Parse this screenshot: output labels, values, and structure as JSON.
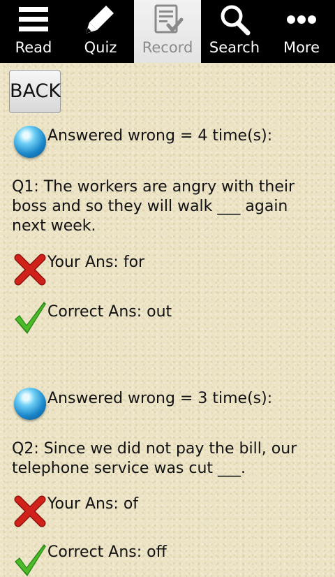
{
  "tabs": [
    {
      "label": "Read",
      "icon": "menu-lines-icon",
      "selected": false
    },
    {
      "label": "Quiz",
      "icon": "pencil-icon",
      "selected": false
    },
    {
      "label": "Record",
      "icon": "record-checklist-icon",
      "selected": true
    },
    {
      "label": "Search",
      "icon": "search-icon",
      "selected": false
    },
    {
      "label": "More",
      "icon": "more-dots-icon",
      "selected": false
    }
  ],
  "back_label": "BACK",
  "records": [
    {
      "wrong_count_text": "Answered wrong = 4 time(s):",
      "question": "Q1: The workers are angry with their boss and so they will walk ___ again next week.",
      "your_answer": "Your Ans: for",
      "correct_answer": "Correct Ans: out"
    },
    {
      "wrong_count_text": "Answered wrong = 3 time(s):",
      "question": "Q2: Since we did not pay the bill, our telephone service was cut ___.",
      "your_answer": "Your Ans: of",
      "correct_answer": "Correct Ans: off"
    }
  ],
  "colors": {
    "tabbar_bg": "#000000",
    "selected_tab_bg": "#e8e8e8",
    "paper_bg": "#ece3c4",
    "wrong_mark": "#d0221b",
    "correct_mark": "#3aa31e",
    "orb": "#2a9ad8"
  }
}
